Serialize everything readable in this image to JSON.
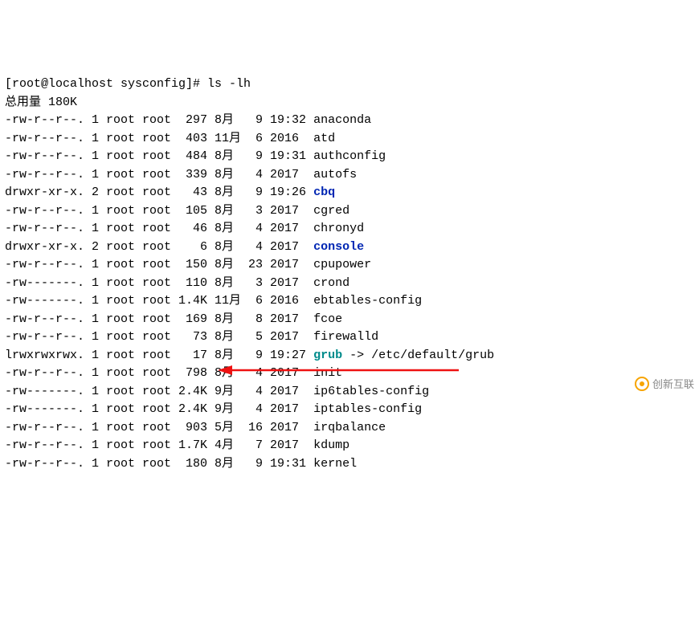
{
  "prompt": "[root@localhost sysconfig]# ",
  "command": "ls -lh",
  "total_label": "总用量 180K",
  "rows": [
    {
      "perm": "-rw-r--r--.",
      "links": "1",
      "owner": "root",
      "group": "root",
      "size": " 297",
      "month": "8月 ",
      "day": " 9",
      "time": "19:32",
      "name": "anaconda",
      "type": "file"
    },
    {
      "perm": "-rw-r--r--.",
      "links": "1",
      "owner": "root",
      "group": "root",
      "size": " 403",
      "month": "11月",
      "day": " 6",
      "time": "2016 ",
      "name": "atd",
      "type": "file"
    },
    {
      "perm": "-rw-r--r--.",
      "links": "1",
      "owner": "root",
      "group": "root",
      "size": " 484",
      "month": "8月 ",
      "day": " 9",
      "time": "19:31",
      "name": "authconfig",
      "type": "file"
    },
    {
      "perm": "-rw-r--r--.",
      "links": "1",
      "owner": "root",
      "group": "root",
      "size": " 339",
      "month": "8月 ",
      "day": " 4",
      "time": "2017 ",
      "name": "autofs",
      "type": "file"
    },
    {
      "perm": "drwxr-xr-x.",
      "links": "2",
      "owner": "root",
      "group": "root",
      "size": "  43",
      "month": "8月 ",
      "day": " 9",
      "time": "19:26",
      "name": "cbq",
      "type": "dir"
    },
    {
      "perm": "-rw-r--r--.",
      "links": "1",
      "owner": "root",
      "group": "root",
      "size": " 105",
      "month": "8月 ",
      "day": " 3",
      "time": "2017 ",
      "name": "cgred",
      "type": "file"
    },
    {
      "perm": "-rw-r--r--.",
      "links": "1",
      "owner": "root",
      "group": "root",
      "size": "  46",
      "month": "8月 ",
      "day": " 4",
      "time": "2017 ",
      "name": "chronyd",
      "type": "file"
    },
    {
      "perm": "drwxr-xr-x.",
      "links": "2",
      "owner": "root",
      "group": "root",
      "size": "   6",
      "month": "8月 ",
      "day": " 4",
      "time": "2017 ",
      "name": "console",
      "type": "dir"
    },
    {
      "perm": "-rw-r--r--.",
      "links": "1",
      "owner": "root",
      "group": "root",
      "size": " 150",
      "month": "8月 ",
      "day": "23",
      "time": "2017 ",
      "name": "cpupower",
      "type": "file"
    },
    {
      "perm": "-rw-------.",
      "links": "1",
      "owner": "root",
      "group": "root",
      "size": " 110",
      "month": "8月 ",
      "day": " 3",
      "time": "2017 ",
      "name": "crond",
      "type": "file"
    },
    {
      "perm": "-rw-------.",
      "links": "1",
      "owner": "root",
      "group": "root",
      "size": "1.4K",
      "month": "11月",
      "day": " 6",
      "time": "2016 ",
      "name": "ebtables-config",
      "type": "file"
    },
    {
      "perm": "-rw-r--r--.",
      "links": "1",
      "owner": "root",
      "group": "root",
      "size": " 169",
      "month": "8月 ",
      "day": " 8",
      "time": "2017 ",
      "name": "fcoe",
      "type": "file"
    },
    {
      "perm": "-rw-r--r--.",
      "links": "1",
      "owner": "root",
      "group": "root",
      "size": "  73",
      "month": "8月 ",
      "day": " 5",
      "time": "2017 ",
      "name": "firewalld",
      "type": "file"
    },
    {
      "perm": "lrwxrwxrwx.",
      "links": "1",
      "owner": "root",
      "group": "root",
      "size": "  17",
      "month": "8月 ",
      "day": " 9",
      "time": "19:27",
      "name": "grub",
      "type": "symlink",
      "target": " -> /etc/default/grub"
    },
    {
      "perm": "-rw-r--r--.",
      "links": "1",
      "owner": "root",
      "group": "root",
      "size": " 798",
      "month": "8月 ",
      "day": " 4",
      "time": "2017 ",
      "name": "init",
      "type": "file"
    },
    {
      "perm": "-rw-------.",
      "links": "1",
      "owner": "root",
      "group": "root",
      "size": "2.4K",
      "month": "9月 ",
      "day": " 4",
      "time": "2017 ",
      "name": "ip6tables-config",
      "type": "file"
    },
    {
      "perm": "-rw-------.",
      "links": "1",
      "owner": "root",
      "group": "root",
      "size": "2.4K",
      "month": "9月 ",
      "day": " 4",
      "time": "2017 ",
      "name": "iptables-config",
      "type": "file"
    },
    {
      "perm": "-rw-r--r--.",
      "links": "1",
      "owner": "root",
      "group": "root",
      "size": " 903",
      "month": "5月 ",
      "day": "16",
      "time": "2017 ",
      "name": "irqbalance",
      "type": "file"
    },
    {
      "perm": "-rw-r--r--.",
      "links": "1",
      "owner": "root",
      "group": "root",
      "size": "1.7K",
      "month": "4月 ",
      "day": " 7",
      "time": "2017 ",
      "name": "kdump",
      "type": "file"
    },
    {
      "perm": "-rw-r--r--.",
      "links": "1",
      "owner": "root",
      "group": "root",
      "size": " 180",
      "month": "8月 ",
      "day": " 9",
      "time": "19:31",
      "name": "kernel",
      "type": "file"
    }
  ],
  "watermark_text": "创新互联",
  "arrow_color": "#e11"
}
